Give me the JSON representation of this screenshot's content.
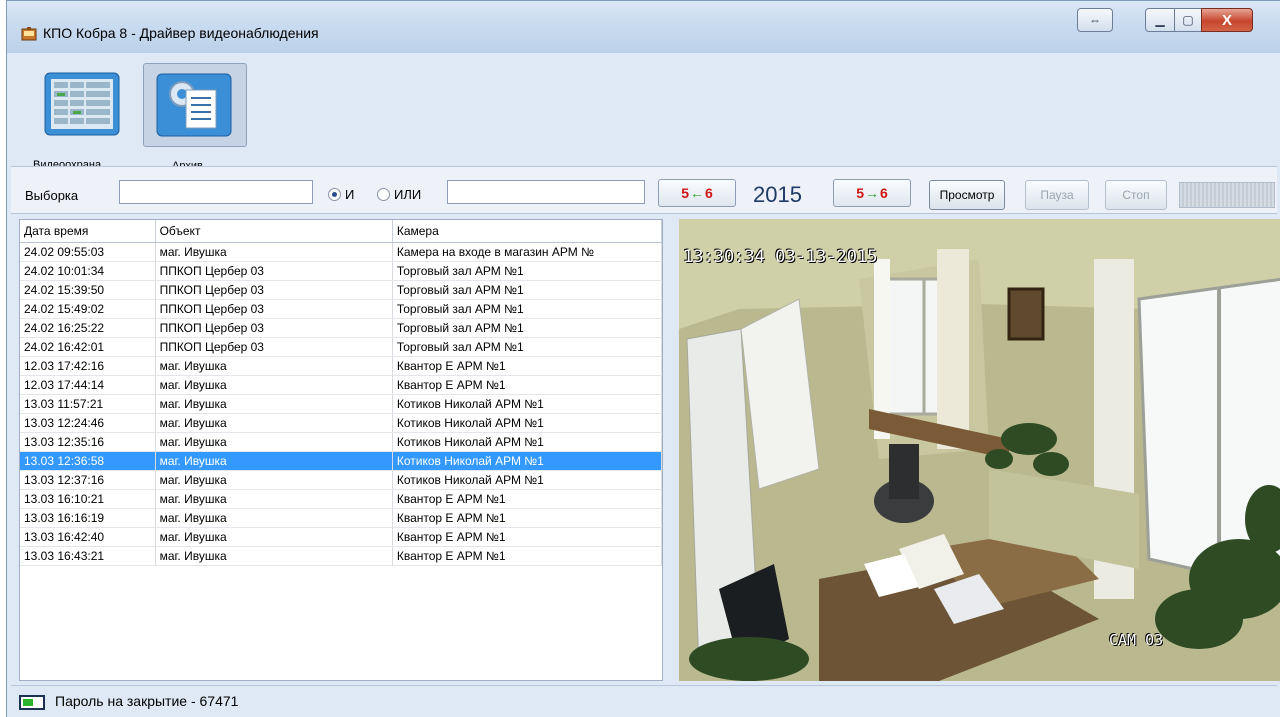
{
  "window": {
    "title": "КПО Кобра 8 - Драйвер видеонаблюдения",
    "close_glyph": "X"
  },
  "toolbar": {
    "videoguard_label": "Видеоохрана",
    "archive_label": "Архив"
  },
  "filter": {
    "label": "Выборка",
    "input1_value": "",
    "input2_value": "",
    "and_label": "И",
    "or_label": "ИЛИ",
    "and_checked": true,
    "date_prev": {
      "from": "5",
      "to": "6"
    },
    "year": "2015",
    "date_next": {
      "from": "5",
      "to": "6"
    },
    "view_label": "Просмотр",
    "pause_label": "Пауза",
    "stop_label": "Стоп"
  },
  "table": {
    "headers": [
      "Дата время",
      "Объект",
      "Камера"
    ],
    "selected_index": 11,
    "rows": [
      [
        "24.02 09:55:03",
        "маг. Ивушка",
        "Камера на входе в магазин АРМ №"
      ],
      [
        "24.02 10:01:34",
        "ППКОП Цербер 03",
        "Торговый зал АРМ №1"
      ],
      [
        "24.02 15:39:50",
        "ППКОП Цербер 03",
        "Торговый зал АРМ №1"
      ],
      [
        "24.02 15:49:02",
        "ППКОП Цербер 03",
        "Торговый зал АРМ №1"
      ],
      [
        "24.02 16:25:22",
        "ППКОП Цербер 03",
        "Торговый зал АРМ №1"
      ],
      [
        "24.02 16:42:01",
        "ППКОП Цербер 03",
        "Торговый зал АРМ №1"
      ],
      [
        "12.03 17:42:16",
        "маг. Ивушка",
        "Квантор Е АРМ №1"
      ],
      [
        "12.03 17:44:14",
        "маг. Ивушка",
        "Квантор Е АРМ №1"
      ],
      [
        "13.03 11:57:21",
        "маг. Ивушка",
        "Котиков Николай АРМ №1"
      ],
      [
        "13.03 12:24:46",
        "маг. Ивушка",
        "Котиков Николай АРМ №1"
      ],
      [
        "13.03 12:35:16",
        "маг. Ивушка",
        "Котиков Николай АРМ №1"
      ],
      [
        "13.03 12:36:58",
        "маг. Ивушка",
        "Котиков Николай АРМ №1"
      ],
      [
        "13.03 12:37:16",
        "маг. Ивушка",
        "Котиков Николай АРМ №1"
      ],
      [
        "13.03 16:10:21",
        "маг. Ивушка",
        "Квантор Е АРМ №1"
      ],
      [
        "13.03 16:16:19",
        "маг. Ивушка",
        "Квантор Е АРМ №1"
      ],
      [
        "13.03 16:42:40",
        "маг. Ивушка",
        "Квантор Е АРМ №1"
      ],
      [
        "13.03 16:43:21",
        "маг. Ивушка",
        "Квантор Е АРМ №1"
      ]
    ]
  },
  "video": {
    "timestamp": "13:30:34 03-13-2015",
    "camera_label": "CAM 03"
  },
  "statusbar": {
    "text": "Пароль на закрытие - 67471"
  }
}
